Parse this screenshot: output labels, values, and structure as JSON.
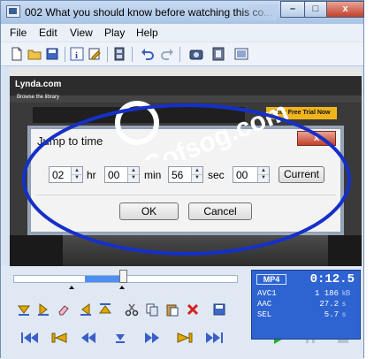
{
  "window": {
    "title": "002 What you should know before watching this co...",
    "minimize_glyph": "–",
    "maximize_glyph": "□",
    "close_glyph": "x"
  },
  "menu": [
    "File",
    "Edit",
    "View",
    "Play",
    "Help"
  ],
  "toolbar": {
    "icons": [
      "new-file-icon",
      "open-folder-icon",
      "save-disk-icon",
      "info-icon",
      "edit-properties-icon",
      "filmstrip-icon",
      "undo-icon",
      "redo-icon",
      "snapshot-camera-icon",
      "clip-icon",
      "fit-window-icon"
    ]
  },
  "video": {
    "site_logo": "Lynda.com",
    "banner_button": "Your Free Trial Now",
    "browse_label": "Browse the library"
  },
  "dialog": {
    "title": "Jump to time",
    "close_glyph": "x",
    "fields": [
      {
        "value": "02",
        "unit": "hr"
      },
      {
        "value": "00",
        "unit": "min"
      },
      {
        "value": "56",
        "unit": "sec"
      },
      {
        "value": "00",
        "unit": ""
      }
    ],
    "current_label": "Current",
    "ok_label": "OK",
    "cancel_label": "Cancel"
  },
  "watermark": {
    "text": "Sofsog.com",
    "color": "#ffffff"
  },
  "highlight": {
    "color": "#1530c8"
  },
  "playback": {
    "progress": 0.49,
    "info": {
      "format": "MP4",
      "time": "0:12.5",
      "rows": [
        {
          "label": "AVC1",
          "value": "1 186",
          "unit": "kB"
        },
        {
          "label": "AAC",
          "value": "27.2",
          "unit": "s"
        },
        {
          "label": "SEL",
          "value": "5.7",
          "unit": "s"
        }
      ]
    }
  },
  "colors": {
    "play_green": "#1db31d",
    "transport_blue": "#3a5fc8",
    "edit_yellow": "#e0a800",
    "delete_red": "#d42020"
  }
}
